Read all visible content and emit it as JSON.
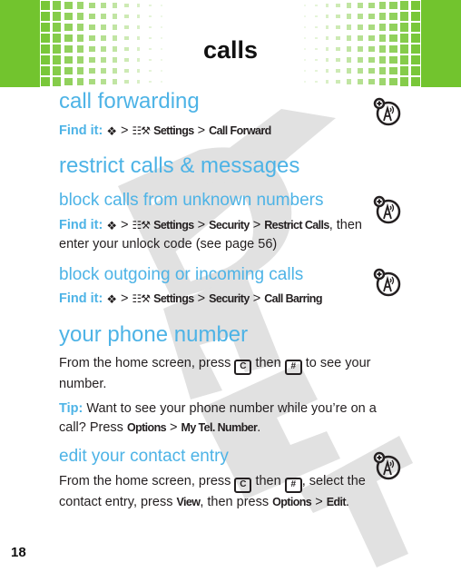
{
  "header": {
    "title": "calls",
    "band_color": "#72c42e"
  },
  "watermark": {
    "text": "DRAFT",
    "color": "#d9d9d9"
  },
  "accent_color": "#4db3e6",
  "sections": {
    "call_forwarding": {
      "heading": "call forwarding",
      "find_it_label": "Find it:",
      "path": {
        "sep": ">",
        "settings": "Settings",
        "item": "Call Forward"
      },
      "icon": "network-feature-icon"
    },
    "restrict": {
      "heading": "restrict calls & messages"
    },
    "block_unknown": {
      "heading": "block calls from unknown numbers",
      "find_it_label": "Find it:",
      "path": {
        "sep": ">",
        "settings": "Settings",
        "security": "Security",
        "item": "Restrict Calls"
      },
      "tail": ", then enter your unlock code (see page 56)",
      "icon": "network-feature-icon"
    },
    "block_outgoing": {
      "heading": "block outgoing or incoming calls",
      "find_it_label": "Find it:",
      "path": {
        "sep": ">",
        "settings": "Settings",
        "security": "Security",
        "item": "Call Barring"
      },
      "icon": "network-feature-icon"
    },
    "phone_number": {
      "heading": "your phone number",
      "text1": "From the home screen, press",
      "key1": "C",
      "text2": "then",
      "key2": "#",
      "text3": "to see your number.",
      "tip_label": "Tip:",
      "tip_text": "Want to see your phone number while you’re on a call? Press",
      "tip_opt": "Options",
      "tip_sep": ">",
      "tip_item": "My Tel. Number",
      "tip_end": "."
    },
    "edit_contact": {
      "heading": "edit your contact entry",
      "text1": "From the home screen, press",
      "key1": "C",
      "text2": "then",
      "key2": "#",
      "text3": ", select the contact entry, press",
      "view": "View",
      "text4": ", then press",
      "opt": "Options",
      "sep": ">",
      "item": "Edit",
      "end": ".",
      "icon": "network-feature-icon"
    }
  },
  "page_number": "18"
}
